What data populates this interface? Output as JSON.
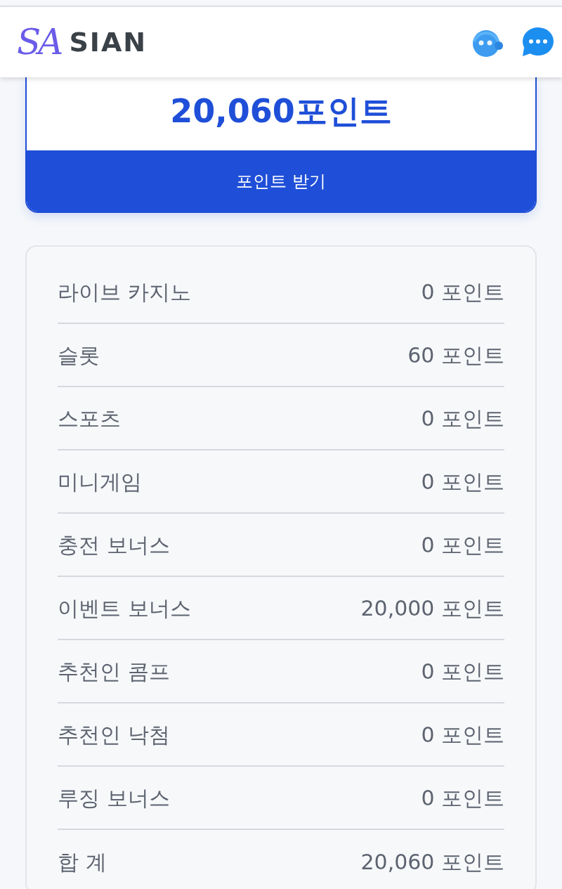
{
  "header": {
    "logo_mark": "SA",
    "logo_name": "SIAN"
  },
  "points_card": {
    "total": "20,060포인트",
    "claim_button": "포인트 받기"
  },
  "breakdown": [
    {
      "label": "라이브 카지노",
      "value": "0 포인트"
    },
    {
      "label": "슬롯",
      "value": "60 포인트"
    },
    {
      "label": "스포츠",
      "value": "0 포인트"
    },
    {
      "label": "미니게임",
      "value": "0 포인트"
    },
    {
      "label": "충전 보너스",
      "value": "0 포인트"
    },
    {
      "label": "이벤트 보너스",
      "value": "20,000 포인트"
    },
    {
      "label": "추천인 콤프",
      "value": "0 포인트"
    },
    {
      "label": "추천인 낙첨",
      "value": "0 포인트"
    },
    {
      "label": "루징 보너스",
      "value": "0 포인트"
    },
    {
      "label": "합 계",
      "value": "20,060 포인트"
    }
  ]
}
